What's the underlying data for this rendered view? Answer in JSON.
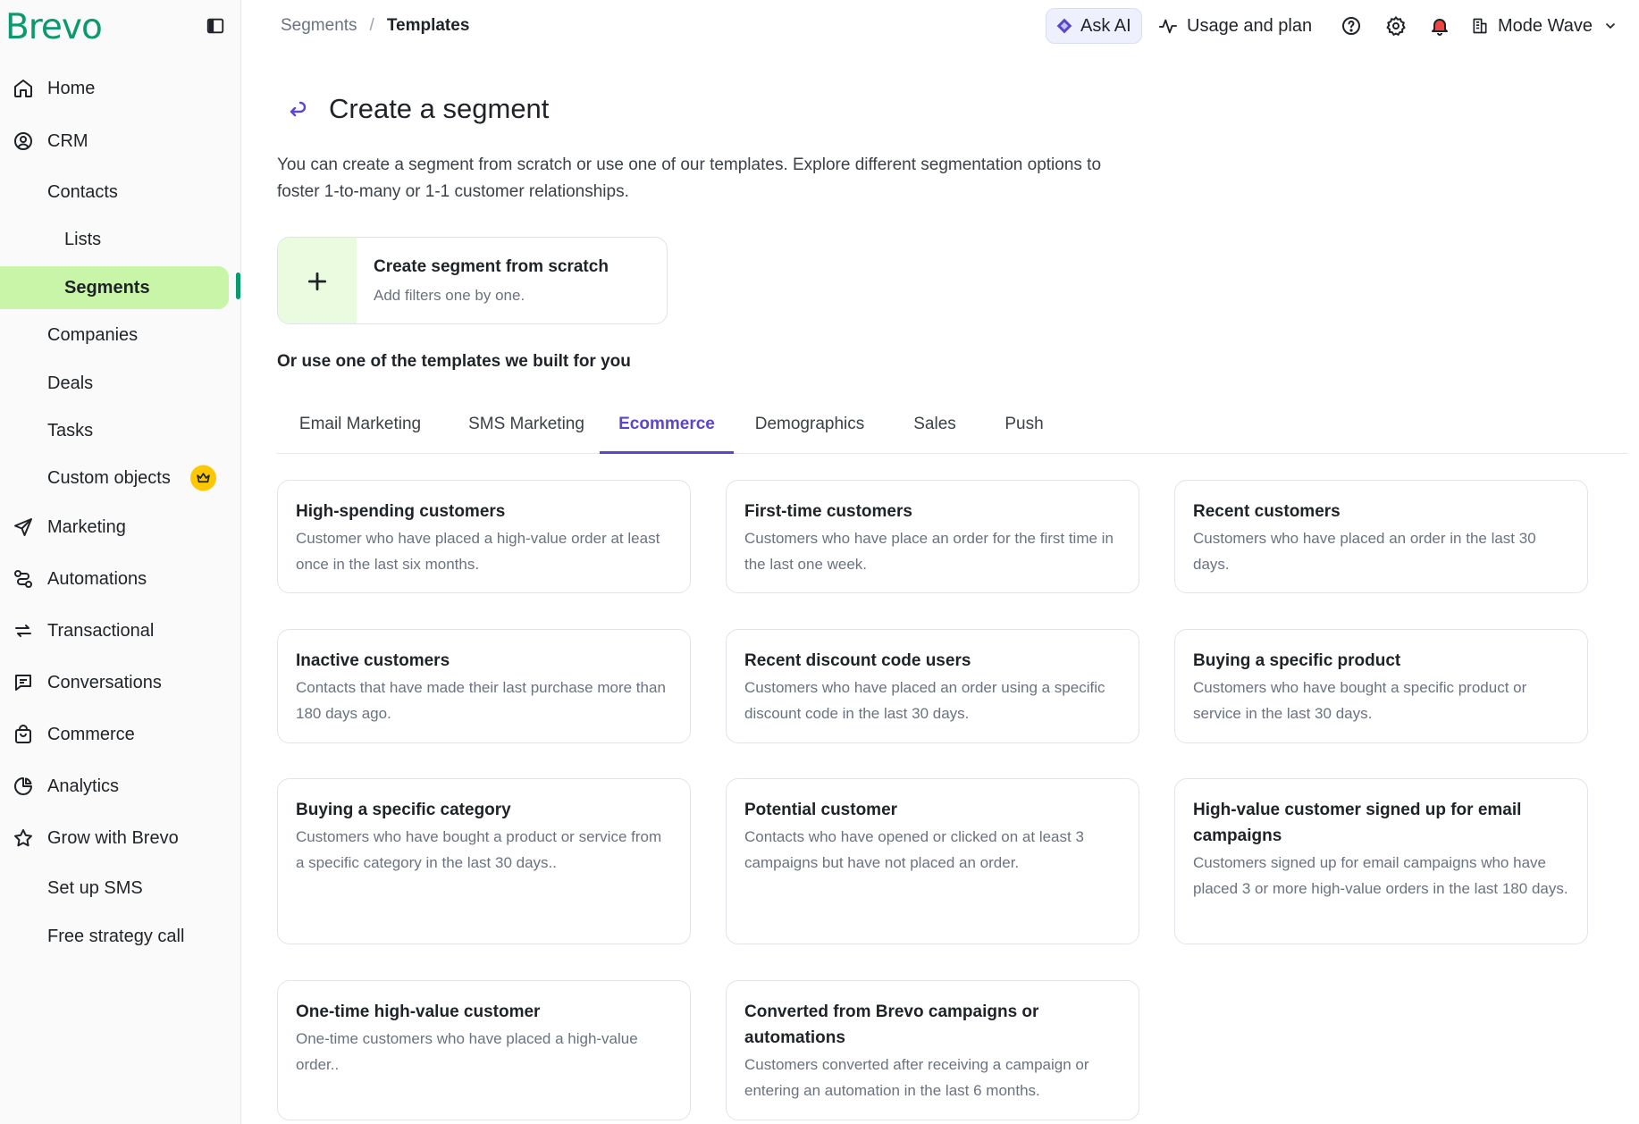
{
  "brand": {
    "logo": "Brevo",
    "accent": "#0b996e",
    "active_bg": "#c9f5a9",
    "tab_accent": "#5a48c9"
  },
  "sidebar": {
    "items": [
      {
        "label": "Home",
        "icon": "home-icon"
      },
      {
        "label": "CRM",
        "icon": "user-circle-icon"
      },
      {
        "label": "Contacts"
      },
      {
        "label": "Lists"
      },
      {
        "label": "Segments"
      },
      {
        "label": "Companies"
      },
      {
        "label": "Deals"
      },
      {
        "label": "Tasks"
      },
      {
        "label": "Custom objects",
        "badge_icon": "crown-icon"
      },
      {
        "label": "Marketing",
        "icon": "send-icon"
      },
      {
        "label": "Automations",
        "icon": "automation-icon"
      },
      {
        "label": "Transactional",
        "icon": "arrows-exchange-icon"
      },
      {
        "label": "Conversations",
        "icon": "chat-icon"
      },
      {
        "label": "Commerce",
        "icon": "shopping-bag-icon"
      },
      {
        "label": "Analytics",
        "icon": "pie-chart-icon"
      },
      {
        "label": "Grow with Brevo",
        "icon": "star-icon"
      },
      {
        "label": "Set up SMS"
      },
      {
        "label": "Free strategy call"
      }
    ]
  },
  "header": {
    "breadcrumb": [
      "Segments",
      "/",
      "Templates"
    ],
    "ask_ai": "Ask AI",
    "usage": "Usage and plan",
    "org_name": "Mode Wave"
  },
  "main": {
    "title": "Create a segment",
    "intro": "You can create a segment from scratch or use one of our templates. Explore different segmentation options to foster 1-to-many or 1-1 customer relationships.",
    "scratch": {
      "title": "Create segment from scratch",
      "subtitle": "Add filters one by one."
    },
    "templates_heading": "Or use one of the templates we built for you",
    "tabs": [
      "Email Marketing",
      "SMS Marketing",
      "Ecommerce",
      "Demographics",
      "Sales",
      "Push"
    ],
    "active_tab": "Ecommerce",
    "cards": [
      {
        "title": "High-spending customers",
        "desc": "Customer who have placed a high-value order at least once in the last six months."
      },
      {
        "title": "First-time customers",
        "desc": "Customers who have place an order for the first time in the last one week."
      },
      {
        "title": "Recent customers",
        "desc": "Customers who have placed an order in the last 30 days."
      },
      {
        "title": "Inactive customers",
        "desc": "Contacts that have made their last purchase more than 180 days ago."
      },
      {
        "title": "Recent discount code users",
        "desc": "Customers who have placed an order using a specific discount code in the last 30 days."
      },
      {
        "title": "Buying a specific product",
        "desc": "Customers who have bought a specific product or service in the last 30 days."
      },
      {
        "title": "Buying a specific category",
        "desc": "Customers who have bought a product or service from a specific category in the last 30 days.."
      },
      {
        "title": "Potential customer",
        "desc": "Contacts who have opened or clicked on at least 3 campaigns but have not placed an order."
      },
      {
        "title": "High-value customer signed up for email campaigns",
        "desc": "Customers signed up for email campaigns who have placed 3 or more high-value orders in the last 180 days."
      },
      {
        "title": "One-time high-value customer",
        "desc": "One-time customers who have placed a high-value order.."
      },
      {
        "title": "Converted from Brevo campaigns or automations",
        "desc": "Customers converted after receiving a campaign or entering an automation in the last 6 months."
      }
    ]
  }
}
